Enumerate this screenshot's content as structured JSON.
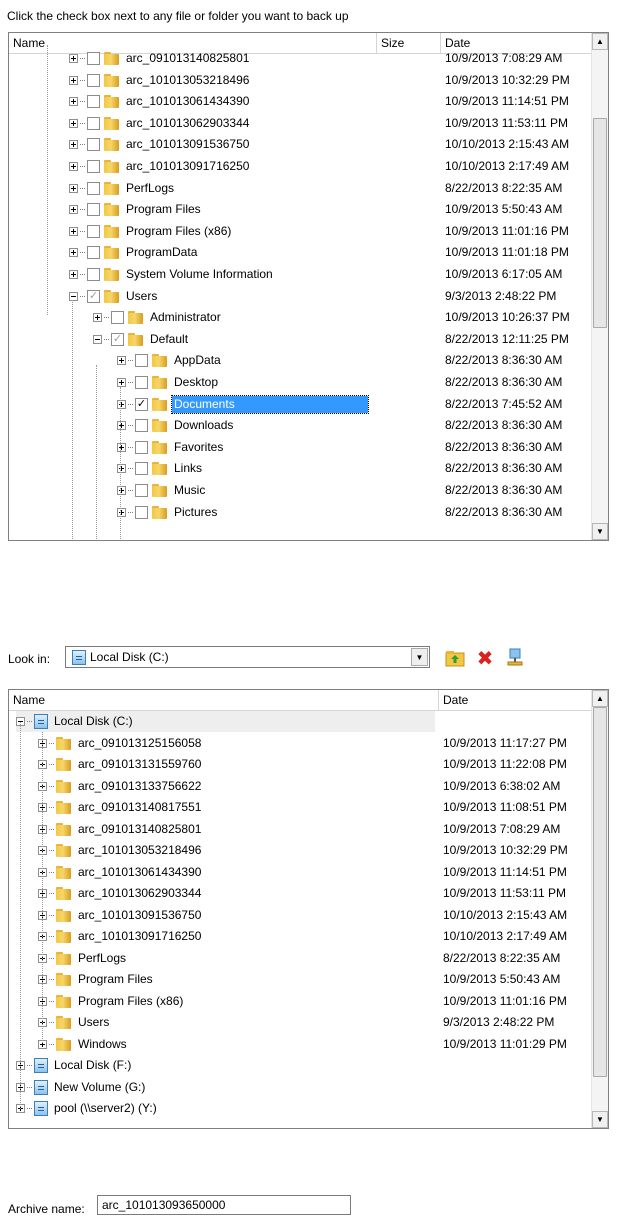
{
  "instruction": "Click the check box next to any file or folder you want to back up",
  "backup_tree": {
    "columns": {
      "name": "Name",
      "size": "Size",
      "date": "Date"
    },
    "rows": [
      {
        "name": "arc_091013140825801",
        "date": "10/9/2013 7:08:29 AM",
        "level": 0,
        "check": "off",
        "expander": "plus"
      },
      {
        "name": "arc_101013053218496",
        "date": "10/9/2013 10:32:29 PM",
        "level": 0,
        "check": "off",
        "expander": "plus"
      },
      {
        "name": "arc_101013061434390",
        "date": "10/9/2013 11:14:51 PM",
        "level": 0,
        "check": "off",
        "expander": "plus"
      },
      {
        "name": "arc_101013062903344",
        "date": "10/9/2013 11:53:11 PM",
        "level": 0,
        "check": "off",
        "expander": "plus"
      },
      {
        "name": "arc_101013091536750",
        "date": "10/10/2013 2:15:43 AM",
        "level": 0,
        "check": "off",
        "expander": "plus"
      },
      {
        "name": "arc_101013091716250",
        "date": "10/10/2013 2:17:49 AM",
        "level": 0,
        "check": "off",
        "expander": "plus"
      },
      {
        "name": "PerfLogs",
        "date": "8/22/2013 8:22:35 AM",
        "level": 0,
        "check": "off",
        "expander": "plus"
      },
      {
        "name": "Program Files",
        "date": "10/9/2013 5:50:43 AM",
        "level": 0,
        "check": "off",
        "expander": "plus"
      },
      {
        "name": "Program Files (x86)",
        "date": "10/9/2013 11:01:16 PM",
        "level": 0,
        "check": "off",
        "expander": "plus"
      },
      {
        "name": "ProgramData",
        "date": "10/9/2013 11:01:18 PM",
        "level": 0,
        "check": "off",
        "expander": "plus"
      },
      {
        "name": "System Volume Information",
        "date": "10/9/2013 6:17:05 AM",
        "level": 0,
        "check": "off",
        "expander": "plus"
      },
      {
        "name": "Users",
        "date": "9/3/2013 2:48:22 PM",
        "level": 0,
        "check": "partial",
        "expander": "minus"
      },
      {
        "name": "Administrator",
        "date": "10/9/2013 10:26:37 PM",
        "level": 1,
        "check": "off",
        "expander": "plus"
      },
      {
        "name": "Default",
        "date": "8/22/2013 12:11:25 PM",
        "level": 1,
        "check": "partial",
        "expander": "minus"
      },
      {
        "name": "AppData",
        "date": "8/22/2013 8:36:30 AM",
        "level": 2,
        "check": "off",
        "expander": "plus"
      },
      {
        "name": "Desktop",
        "date": "8/22/2013 8:36:30 AM",
        "level": 2,
        "check": "off",
        "expander": "plus"
      },
      {
        "name": "Documents",
        "date": "8/22/2013 7:45:52 AM",
        "level": 2,
        "check": "on",
        "expander": "plus",
        "selected": true
      },
      {
        "name": "Downloads",
        "date": "8/22/2013 8:36:30 AM",
        "level": 2,
        "check": "off",
        "expander": "plus"
      },
      {
        "name": "Favorites",
        "date": "8/22/2013 8:36:30 AM",
        "level": 2,
        "check": "off",
        "expander": "plus"
      },
      {
        "name": "Links",
        "date": "8/22/2013 8:36:30 AM",
        "level": 2,
        "check": "off",
        "expander": "plus"
      },
      {
        "name": "Music",
        "date": "8/22/2013 8:36:30 AM",
        "level": 2,
        "check": "off",
        "expander": "plus"
      },
      {
        "name": "Pictures",
        "date": "8/22/2013 8:36:30 AM",
        "level": 2,
        "check": "off",
        "expander": "plus"
      }
    ]
  },
  "look_in": {
    "label": "Look in:",
    "value": "Local Disk (C:)",
    "icons": [
      "folder-up-icon",
      "delete-icon",
      "network-drive-icon"
    ]
  },
  "dest_tree": {
    "columns": {
      "name": "Name",
      "date": "Date"
    },
    "rows": [
      {
        "name": "Local Disk (C:)",
        "date": "",
        "level": 0,
        "icon": "disk",
        "expander": "minus",
        "highlight": true
      },
      {
        "name": "arc_091013125156058",
        "date": "10/9/2013 11:17:27 PM",
        "level": 1,
        "icon": "folder",
        "expander": "plus"
      },
      {
        "name": "arc_091013131559760",
        "date": "10/9/2013 11:22:08 PM",
        "level": 1,
        "icon": "folder",
        "expander": "plus"
      },
      {
        "name": "arc_091013133756622",
        "date": "10/9/2013 6:38:02 AM",
        "level": 1,
        "icon": "folder",
        "expander": "plus"
      },
      {
        "name": "arc_091013140817551",
        "date": "10/9/2013 11:08:51 PM",
        "level": 1,
        "icon": "folder",
        "expander": "plus"
      },
      {
        "name": "arc_091013140825801",
        "date": "10/9/2013 7:08:29 AM",
        "level": 1,
        "icon": "folder",
        "expander": "plus"
      },
      {
        "name": "arc_101013053218496",
        "date": "10/9/2013 10:32:29 PM",
        "level": 1,
        "icon": "folder",
        "expander": "plus"
      },
      {
        "name": "arc_101013061434390",
        "date": "10/9/2013 11:14:51 PM",
        "level": 1,
        "icon": "folder",
        "expander": "plus"
      },
      {
        "name": "arc_101013062903344",
        "date": "10/9/2013 11:53:11 PM",
        "level": 1,
        "icon": "folder",
        "expander": "plus"
      },
      {
        "name": "arc_101013091536750",
        "date": "10/10/2013 2:15:43 AM",
        "level": 1,
        "icon": "folder",
        "expander": "plus"
      },
      {
        "name": "arc_101013091716250",
        "date": "10/10/2013 2:17:49 AM",
        "level": 1,
        "icon": "folder",
        "expander": "plus"
      },
      {
        "name": "PerfLogs",
        "date": "8/22/2013 8:22:35 AM",
        "level": 1,
        "icon": "folder",
        "expander": "plus"
      },
      {
        "name": "Program Files",
        "date": "10/9/2013 5:50:43 AM",
        "level": 1,
        "icon": "folder",
        "expander": "plus"
      },
      {
        "name": "Program Files (x86)",
        "date": "10/9/2013 11:01:16 PM",
        "level": 1,
        "icon": "folder",
        "expander": "plus"
      },
      {
        "name": "Users",
        "date": "9/3/2013 2:48:22 PM",
        "level": 1,
        "icon": "folder",
        "expander": "plus"
      },
      {
        "name": "Windows",
        "date": "10/9/2013 11:01:29 PM",
        "level": 1,
        "icon": "folder",
        "expander": "plus"
      },
      {
        "name": "Local Disk (F:)",
        "date": "",
        "level": 0,
        "icon": "disk",
        "expander": "plus"
      },
      {
        "name": "New Volume (G:)",
        "date": "",
        "level": 0,
        "icon": "disk",
        "expander": "plus"
      },
      {
        "name": "pool (\\\\server2) (Y:)",
        "date": "",
        "level": 0,
        "icon": "disk",
        "expander": "plus"
      }
    ]
  },
  "archive": {
    "label": "Archive name:",
    "value": "arc_101013093650000"
  },
  "colors": {
    "selection": "#3399ff",
    "folder": "#f2c744",
    "delete": "#d9231c"
  }
}
